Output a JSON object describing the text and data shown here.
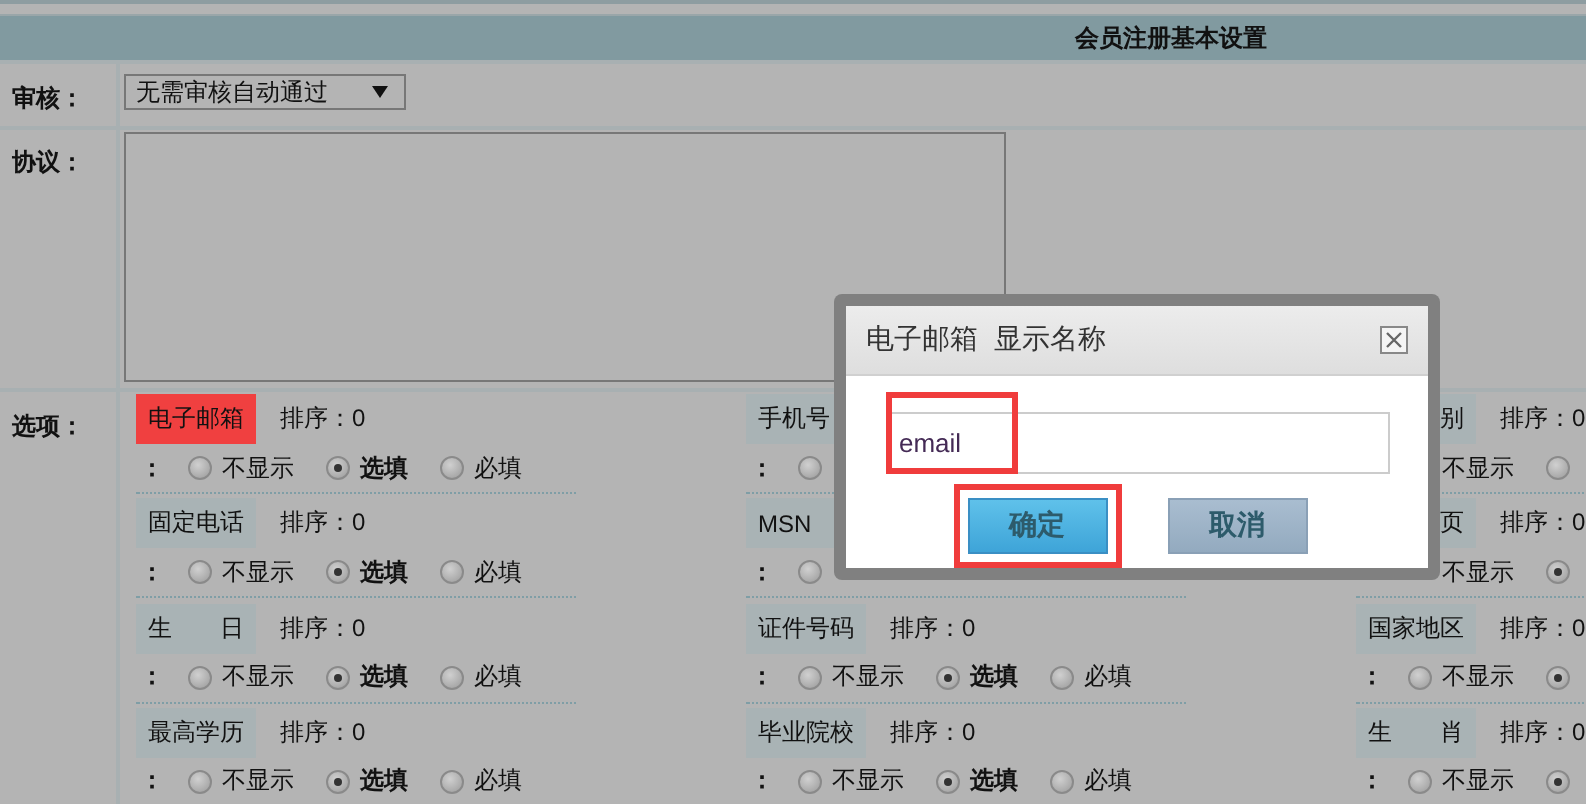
{
  "header": {
    "title": "会员注册基本设置"
  },
  "review": {
    "label": "审核：",
    "value": "无需审核自动通过"
  },
  "agreement": {
    "label": "协议："
  },
  "options": {
    "label": "选项：",
    "columns": [
      [
        {
          "label": "电子邮箱",
          "highlighted": true,
          "order": "排序：0",
          "prefix": "：",
          "choices": [
            {
              "label": "不显示",
              "selected": false
            },
            {
              "label": "选填",
              "selected": true
            },
            {
              "label": "必填",
              "selected": false
            }
          ]
        },
        {
          "label": "固定电话",
          "highlighted": false,
          "order": "排序：0",
          "prefix": "：",
          "choices": [
            {
              "label": "不显示",
              "selected": false
            },
            {
              "label": "选填",
              "selected": true
            },
            {
              "label": "必填",
              "selected": false
            }
          ]
        },
        {
          "label": "生　　日",
          "highlighted": false,
          "order": "排序：0",
          "prefix": "：",
          "choices": [
            {
              "label": "不显示",
              "selected": false
            },
            {
              "label": "选填",
              "selected": true
            },
            {
              "label": "必填",
              "selected": false
            }
          ]
        },
        {
          "label": "最高学历",
          "highlighted": false,
          "order": "排序：0",
          "prefix": "：",
          "choices": [
            {
              "label": "不显示",
              "selected": false
            },
            {
              "label": "选填",
              "selected": true
            },
            {
              "label": "必填",
              "selected": false
            }
          ]
        }
      ],
      [
        {
          "label": "手机号",
          "highlighted": false,
          "prefix": "：",
          "choices": [
            {
              "selected": false
            }
          ]
        },
        {
          "label": "MSN",
          "highlighted": false,
          "prefix": "：",
          "choices": [
            {
              "selected": false
            }
          ]
        },
        {
          "label": "证件号码",
          "highlighted": false,
          "order": "排序：0",
          "prefix": "：",
          "choices": [
            {
              "label": "不显示",
              "selected": false
            },
            {
              "label": "选填",
              "selected": true
            },
            {
              "label": "必填",
              "selected": false
            }
          ]
        },
        {
          "label": "毕业院校",
          "highlighted": false,
          "order": "排序：0",
          "prefix": "：",
          "choices": [
            {
              "label": "不显示",
              "selected": false
            },
            {
              "label": "选填",
              "selected": true
            },
            {
              "label": "必填",
              "selected": false
            }
          ]
        }
      ],
      [
        {
          "label": "别",
          "highlighted": false,
          "order": "排序：0",
          "choices": [
            {
              "label": "不显示"
            },
            {
              "selected": false
            }
          ]
        },
        {
          "label": "页",
          "highlighted": false,
          "order": "排序：0",
          "choices": [
            {
              "label": "不显示"
            },
            {
              "selected": true
            }
          ]
        },
        {
          "label": "国家地区",
          "highlighted": false,
          "order": "排序：0",
          "prefix": "：",
          "choices": [
            {
              "label": "不显示",
              "selected": false
            },
            {
              "selected": true
            }
          ]
        },
        {
          "label": "生　　肖",
          "highlighted": false,
          "order": "排序：0",
          "prefix": "：",
          "choices": [
            {
              "label": "不显示",
              "selected": false
            },
            {
              "selected": true
            }
          ]
        }
      ]
    ]
  },
  "dialog": {
    "title": "电子邮箱  显示名称",
    "input": {
      "value": "email",
      "highlighted": true
    },
    "buttons": [
      {
        "label": "确定",
        "kind": "primary",
        "highlighted": true
      },
      {
        "label": "取消",
        "kind": "secondary",
        "highlighted": false
      }
    ]
  }
}
